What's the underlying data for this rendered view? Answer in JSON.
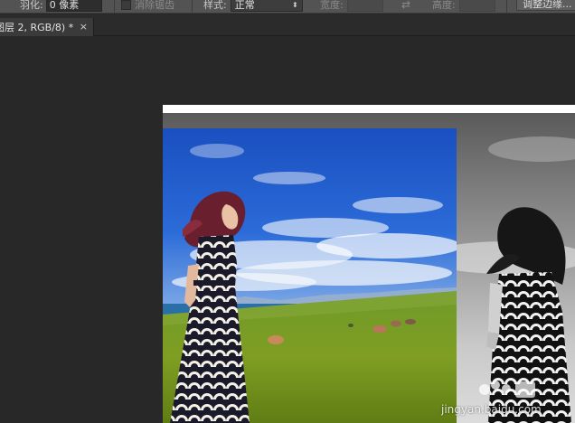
{
  "options_bar": {
    "feather_label": "羽化:",
    "feather_value": "0 像素",
    "antialias_label": "消除锯齿",
    "style_label": "样式:",
    "style_value": "正常",
    "width_label": "宽度:",
    "height_label": "高度:",
    "refine_edge_label": "调整边缘..."
  },
  "document_tab": {
    "title": "图层 2, RGB/8) *",
    "close_glyph": "×"
  },
  "canvas": {
    "watermark_text": "jingyan.baidu.com"
  },
  "colors": {
    "workspace": "#282828",
    "sky_top": "#1a4fc0",
    "grass": "#7a9a1e"
  }
}
